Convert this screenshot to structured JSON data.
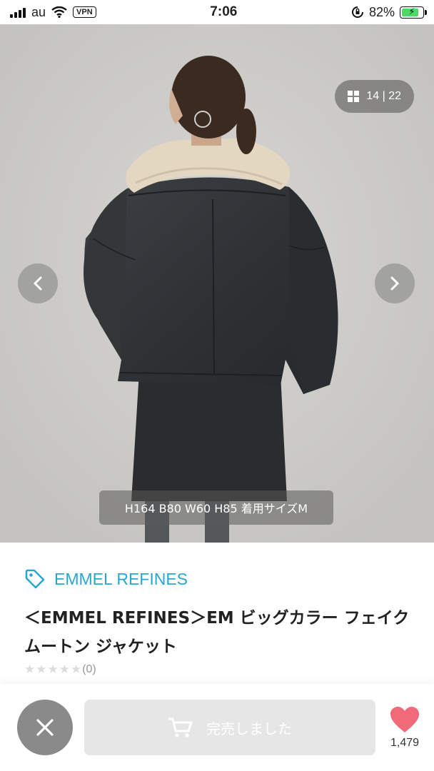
{
  "status_bar": {
    "carrier": "au",
    "vpn": "VPN",
    "time": "7:06",
    "battery_percent": "82%",
    "battery_level": 0.82
  },
  "gallery": {
    "counter": "14 | 22",
    "caption": "H164 B80 W60 H85 着用サイズM",
    "colors": {
      "jacket": "#33363a",
      "collar": "#e3d5c0",
      "background": "#cccbc8"
    }
  },
  "product": {
    "brand": "EMMEL REFINES",
    "title": "＜EMMEL REFINES＞EM ビッグカラー フェイクムートン ジャケット",
    "rating_stars": 0,
    "review_count": "(0)"
  },
  "actions": {
    "soldout_label": "完売しました",
    "like_count": "1,479",
    "colors": {
      "brand": "#2aa6d3",
      "heart": "#f06a7a",
      "disabled": "#e6e6e6"
    }
  }
}
